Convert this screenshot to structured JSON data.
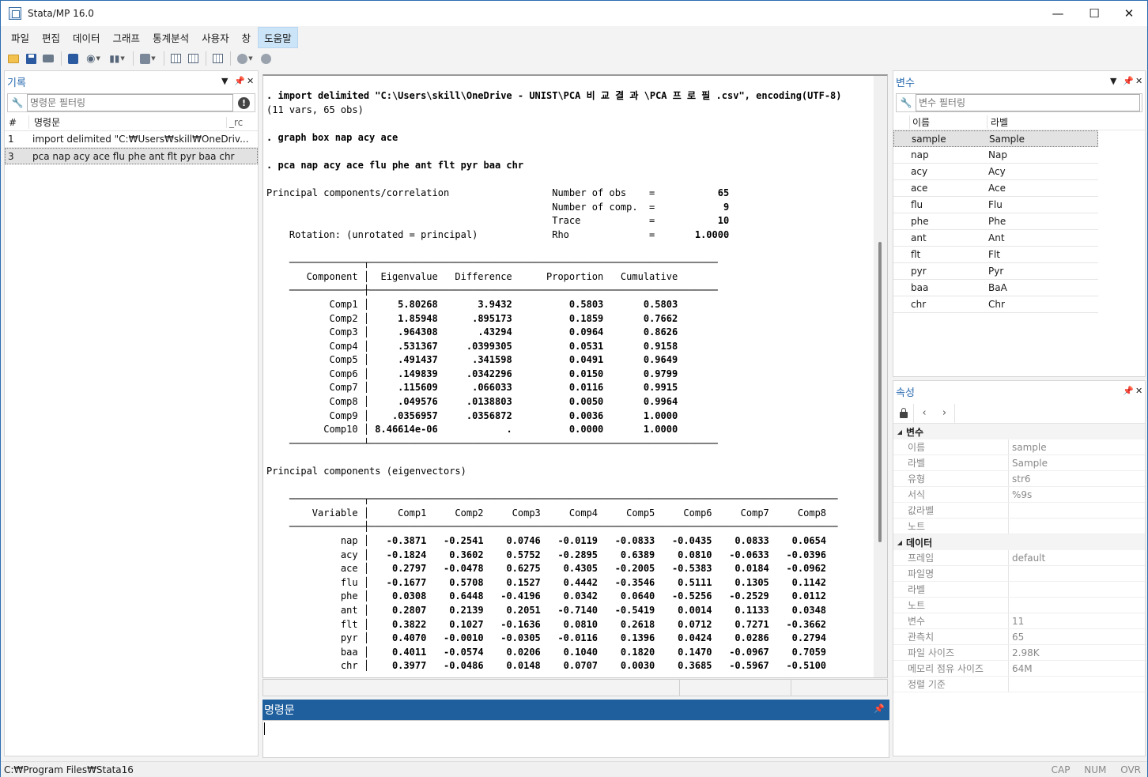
{
  "window": {
    "title": "Stata/MP 16.0",
    "min": "—",
    "max": "☐",
    "close": "✕"
  },
  "menu": [
    "파일",
    "편집",
    "데이터",
    "그래프",
    "통계분석",
    "사용자",
    "창",
    "도움말"
  ],
  "history": {
    "title": "기록",
    "filter_placeholder": "명령문 필터링",
    "col_num": "#",
    "col_cmd": "명령문",
    "col_rc": "_rc",
    "rows": [
      {
        "num": "1",
        "cmd": "import delimited \"C:₩Users₩skill₩OneDriv..."
      },
      {
        "num": "3",
        "cmd": "pca nap acy ace flu phe ant flt pyr baa chr"
      }
    ]
  },
  "results": {
    "cmd1": ". import delimited \"C:\\Users\\skill\\OneDrive - UNIST\\PCA 비 교 결 과 \\PCA 프 로 필 .csv\", encoding(UTF-8)",
    "cmd1_out": "(11 vars, 65 obs)",
    "cmd2": ". graph box nap acy ace",
    "cmd3": ". pca nap acy ace flu phe ant flt pyr baa chr",
    "pc_title": "Principal components/correlation",
    "rotation": "    Rotation: (unrotated = principal)",
    "stats": [
      {
        "label": "Number of obs",
        "value": "65"
      },
      {
        "label": "Number of comp.",
        "value": "9"
      },
      {
        "label": "Trace",
        "value": "10"
      },
      {
        "label": "Rho",
        "value": "1.0000"
      }
    ],
    "eig_headers": [
      "Component",
      "Eigenvalue",
      "Difference",
      "Proportion",
      "Cumulative"
    ],
    "eig_rows": [
      [
        "Comp1",
        "5.80268",
        "3.9432",
        "0.5803",
        "0.5803"
      ],
      [
        "Comp2",
        "1.85948",
        ".895173",
        "0.1859",
        "0.7662"
      ],
      [
        "Comp3",
        ".964308",
        ".43294",
        "0.0964",
        "0.8626"
      ],
      [
        "Comp4",
        ".531367",
        ".0399305",
        "0.0531",
        "0.9158"
      ],
      [
        "Comp5",
        ".491437",
        ".341598",
        "0.0491",
        "0.9649"
      ],
      [
        "Comp6",
        ".149839",
        ".0342296",
        "0.0150",
        "0.9799"
      ],
      [
        "Comp7",
        ".115609",
        ".066033",
        "0.0116",
        "0.9915"
      ],
      [
        "Comp8",
        ".049576",
        ".0138803",
        "0.0050",
        "0.9964"
      ],
      [
        "Comp9",
        ".0356957",
        ".0356872",
        "0.0036",
        "1.0000"
      ],
      [
        "Comp10",
        "8.46614e-06",
        ".",
        "0.0000",
        "1.0000"
      ]
    ],
    "evec_title": "Principal components (eigenvectors)",
    "evec_headers": [
      "Variable",
      "Comp1",
      "Comp2",
      "Comp3",
      "Comp4",
      "Comp5",
      "Comp6",
      "Comp7",
      "Comp8"
    ],
    "evec_rows": [
      [
        "nap",
        "-0.3871",
        "-0.2541",
        "0.0746",
        "-0.0119",
        "-0.0833",
        "-0.0435",
        "0.0833",
        "0.0654"
      ],
      [
        "acy",
        "-0.1824",
        "0.3602",
        "0.5752",
        "-0.2895",
        "0.6389",
        "0.0810",
        "-0.0633",
        "-0.0396"
      ],
      [
        "ace",
        "0.2797",
        "-0.0478",
        "0.6275",
        "0.4305",
        "-0.2005",
        "-0.5383",
        "0.0184",
        "-0.0962"
      ],
      [
        "flu",
        "-0.1677",
        "0.5708",
        "0.1527",
        "0.4442",
        "-0.3546",
        "0.5111",
        "0.1305",
        "0.1142"
      ],
      [
        "phe",
        "0.0308",
        "0.6448",
        "-0.4196",
        "0.0342",
        "0.0640",
        "-0.5256",
        "-0.2529",
        "0.0112"
      ],
      [
        "ant",
        "0.2807",
        "0.2139",
        "0.2051",
        "-0.7140",
        "-0.5419",
        "0.0014",
        "0.1133",
        "0.0348"
      ],
      [
        "flt",
        "0.3822",
        "0.1027",
        "-0.1636",
        "0.0810",
        "0.2618",
        "0.0712",
        "0.7271",
        "-0.3662"
      ],
      [
        "pyr",
        "0.4070",
        "-0.0010",
        "-0.0305",
        "-0.0116",
        "0.1396",
        "0.0424",
        "0.0286",
        "0.2794"
      ],
      [
        "baa",
        "0.4011",
        "-0.0574",
        "0.0206",
        "0.1040",
        "0.1820",
        "0.1470",
        "-0.0967",
        "0.7059"
      ],
      [
        "chr",
        "0.3977",
        "-0.0486",
        "0.0148",
        "0.0707",
        "0.0030",
        "0.3685",
        "-0.5967",
        "-0.5100"
      ]
    ]
  },
  "command": {
    "title": "명령문",
    "value": ""
  },
  "variables": {
    "title": "변수",
    "filter_placeholder": "변수 필터링",
    "col_name": "이름",
    "col_label": "라벨",
    "rows": [
      {
        "name": "sample",
        "label": "Sample"
      },
      {
        "name": "nap",
        "label": "Nap"
      },
      {
        "name": "acy",
        "label": "Acy"
      },
      {
        "name": "ace",
        "label": "Ace"
      },
      {
        "name": "flu",
        "label": "Flu"
      },
      {
        "name": "phe",
        "label": "Phe"
      },
      {
        "name": "ant",
        "label": "Ant"
      },
      {
        "name": "flt",
        "label": "Flt"
      },
      {
        "name": "pyr",
        "label": "Pyr"
      },
      {
        "name": "baa",
        "label": "BaA"
      },
      {
        "name": "chr",
        "label": "Chr"
      }
    ]
  },
  "properties": {
    "title": "속성",
    "sections": [
      {
        "name": "변수",
        "rows": [
          {
            "k": "이름",
            "v": "sample"
          },
          {
            "k": "라벨",
            "v": "Sample"
          },
          {
            "k": "유형",
            "v": "str6"
          },
          {
            "k": "서식",
            "v": "%9s"
          },
          {
            "k": "값라벨",
            "v": ""
          },
          {
            "k": "노트",
            "v": ""
          }
        ]
      },
      {
        "name": "데이터",
        "rows": [
          {
            "k": "프레임",
            "v": "default"
          },
          {
            "k": "파일명",
            "v": ""
          },
          {
            "k": "라벨",
            "v": ""
          },
          {
            "k": "노트",
            "v": ""
          },
          {
            "k": "변수",
            "v": "11"
          },
          {
            "k": "관측치",
            "v": "65"
          },
          {
            "k": "파일 사이즈",
            "v": "2.98K"
          },
          {
            "k": "메모리 점유 사이즈",
            "v": "64M"
          },
          {
            "k": "정렬 기준",
            "v": ""
          }
        ]
      }
    ]
  },
  "status": {
    "path": "C:₩Program Files₩Stata16",
    "cap": "CAP",
    "num": "NUM",
    "ovr": "OVR"
  }
}
